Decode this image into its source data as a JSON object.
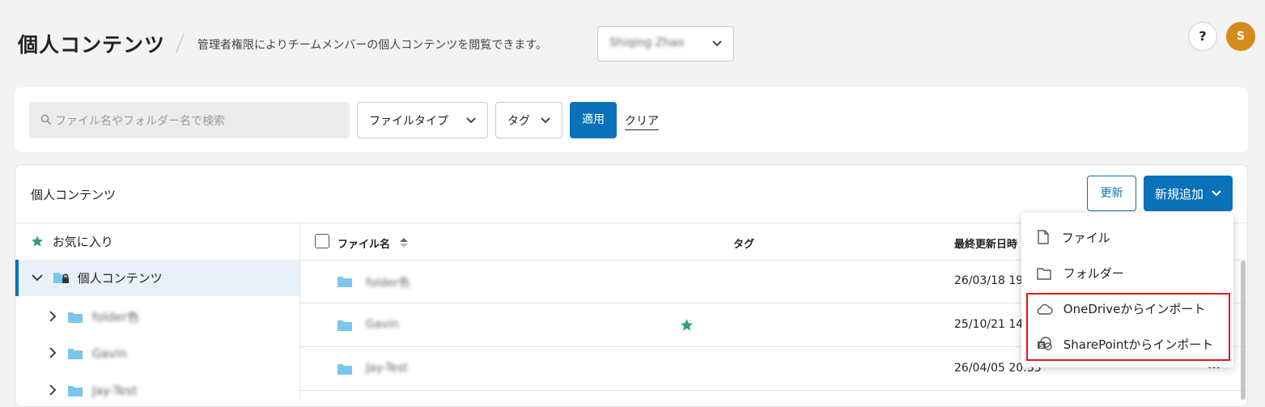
{
  "header": {
    "title": "個人コンテンツ",
    "subtitle": "管理者権限によりチームメンバーの個人コンテンツを閲覧できます。",
    "user_select_value": "Shiqing Zhao",
    "help_label": "?",
    "avatar_initial": "S"
  },
  "filters": {
    "search_placeholder": "ファイル名やフォルダー名で検索",
    "file_type_label": "ファイルタイプ",
    "tag_label": "タグ",
    "apply_label": "適用",
    "clear_label": "クリア"
  },
  "content": {
    "card_title": "個人コンテンツ",
    "refresh_label": "更新",
    "new_label": "新規追加"
  },
  "sidebar": {
    "favorites_label": "お気に入り",
    "root_label": "個人コンテンツ",
    "items": [
      {
        "label": "folder色"
      },
      {
        "label": "Gavin"
      },
      {
        "label": "Jay-Test"
      }
    ]
  },
  "table": {
    "columns": {
      "name": "ファイル名",
      "tag": "タグ",
      "updated": "最終更新日時"
    },
    "rows": [
      {
        "name": "folder色",
        "updated": "26/03/18 19",
        "starred": false
      },
      {
        "name": "Gavin",
        "updated": "25/10/21 14",
        "starred": true
      },
      {
        "name": "Jay-Test",
        "updated": "26/04/05 20:33",
        "starred": false
      }
    ],
    "more_label": "..."
  },
  "menu": {
    "items": [
      {
        "label": "ファイル",
        "icon": "file-icon"
      },
      {
        "label": "フォルダー",
        "icon": "folder-outline-icon"
      },
      {
        "label": "OneDriveからインポート",
        "icon": "cloud-icon"
      },
      {
        "label": "SharePointからインポート",
        "icon": "sharepoint-icon"
      }
    ]
  },
  "colors": {
    "accent": "#0a72b8",
    "highlight": "#e8141b",
    "star": "#2e9e7e",
    "folder": "#7cc6ee",
    "avatar": "#d68b1e"
  }
}
